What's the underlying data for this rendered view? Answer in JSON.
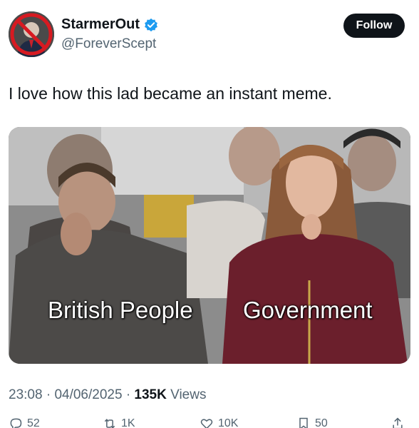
{
  "author": {
    "display_name": "StarmerOut",
    "handle": "@ForeverScept",
    "verified": true,
    "avatar_icon": "avatar-icon"
  },
  "follow_label": "Follow",
  "tweet_text": "I love how this lad became an instant meme.",
  "media": {
    "label_left": "British People",
    "label_right": "Government"
  },
  "meta": {
    "time": "23:08",
    "separator": "·",
    "date": "04/06/2025",
    "views_count": "135K",
    "views_label": "Views"
  },
  "actions": {
    "replies": "52",
    "reposts": "1K",
    "likes": "10K",
    "bookmarks": "50"
  },
  "colors": {
    "accent": "#1d9bf0",
    "text": "#0f1419",
    "secondary": "#536471",
    "follow_bg": "#0f1419"
  }
}
